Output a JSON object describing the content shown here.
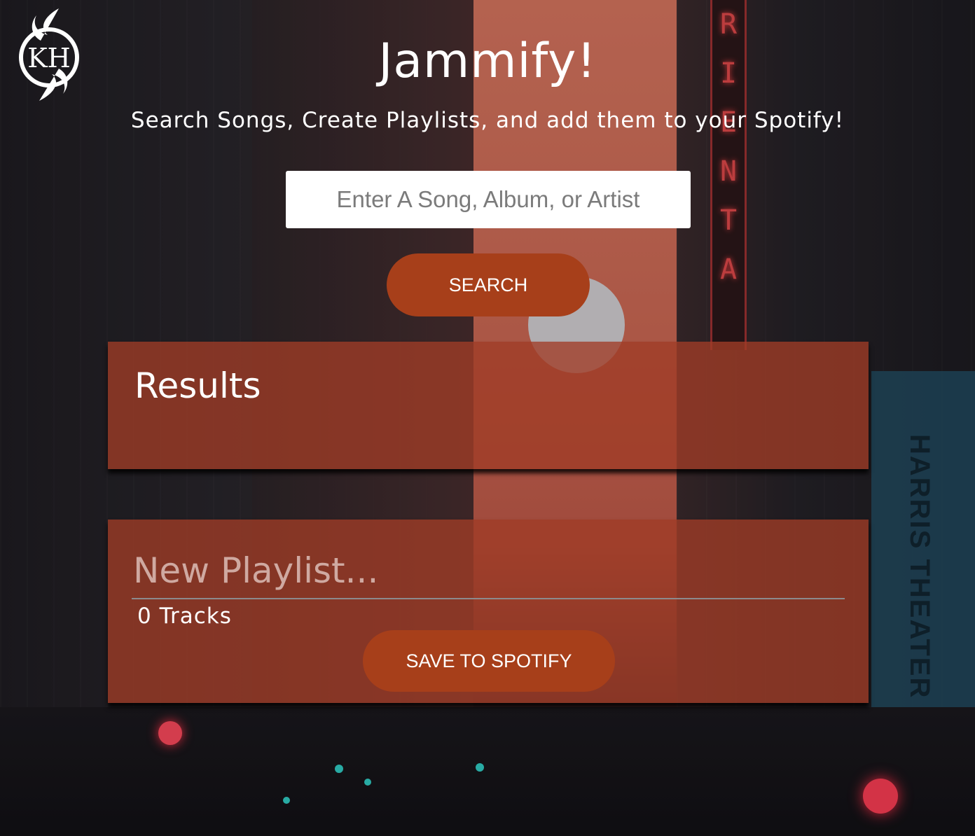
{
  "app": {
    "title": "Jammify!",
    "subtitle": "Search Songs, Create Playlists, and add them to your Spotify!",
    "logo_icon": "kh-logo-icon"
  },
  "search": {
    "placeholder": "Enter A Song, Album, or Artist",
    "value": "",
    "button_label": "SEARCH"
  },
  "results": {
    "title": "Results",
    "items": []
  },
  "playlist": {
    "name_placeholder": "New Playlist...",
    "name_value": "",
    "track_count_label": "0 Tracks",
    "save_label": "SAVE TO SPOTIFY"
  },
  "colors": {
    "accent_button": "#a73f1a",
    "panel": "#a03c26",
    "input_bg": "#ffffff"
  }
}
